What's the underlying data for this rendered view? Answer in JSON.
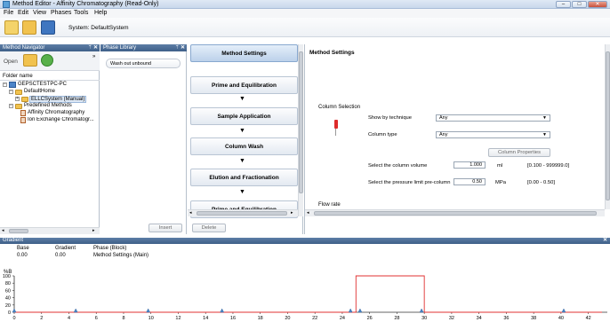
{
  "window": {
    "title": "Method Editor - Affinity Chromatography (Read-Only)",
    "minimize": "–",
    "maximize": "□",
    "close": "✕"
  },
  "menu": [
    "File",
    "Edit",
    "View",
    "Phases",
    "Tools",
    "Help"
  ],
  "toolbar": {
    "system_label": "System: DefaultSystem"
  },
  "navigator": {
    "title": "Method Navigator",
    "pin": "ᛘ",
    "close": "✕",
    "open_label": "Open",
    "chevron": "»",
    "folder_header": "Folder name",
    "tree": {
      "root": "GEPSCTESTPC-PC",
      "default_home": "DefaultHome",
      "ellc": "ELLCSystem (Manual)",
      "predefined": "Predefined Methods",
      "m1": "Affinity Chromatography",
      "m2": "Ion Exchange Chromatogr..."
    }
  },
  "phase_library": {
    "title": "Phase Library",
    "pin": "ᛘ",
    "close": "✕",
    "item": "Wash out unbound",
    "insert": "Insert"
  },
  "phases": {
    "items": [
      "Method Settings",
      "Prime and Equilibration",
      "Sample Application",
      "Column Wash",
      "Elution and Fractionation",
      "Prime and Equilibration"
    ],
    "arrow": "▼",
    "delete": "Delete"
  },
  "editor": {
    "title": "Method Settings",
    "column_selection": "Column Selection",
    "show_by_label": "Show by technique",
    "show_by_value": "Any",
    "column_type_label": "Column type",
    "column_type_value": "Any",
    "column_properties": "Column Properties",
    "volume_label": "Select the column volume",
    "volume_value": "1.000",
    "volume_unit": "ml",
    "volume_range": "[0.100 - 999999.0]",
    "pressure_label": "Select the pressure limit pre-column",
    "pressure_value": "0.50",
    "pressure_unit": "MPa",
    "pressure_range": "[0.00 - 0.50]",
    "flow_rate": "Flow rate"
  },
  "gradient_panel": {
    "title": "Gradient",
    "base_label": "Base",
    "gradient_label": "Gradient",
    "phase_label": "Phase (Block)",
    "base_value": "0.00",
    "gradient_value": "0.00",
    "phase_value": "Method Settings (Main)",
    "close": "✕"
  },
  "chart_data": {
    "type": "line",
    "title": "",
    "xlabel": "",
    "ylabel": "%B",
    "xlim": [
      0,
      43
    ],
    "ylim": [
      0,
      100
    ],
    "x_ticks": [
      0,
      2,
      4,
      6,
      8,
      10,
      12,
      14,
      16,
      18,
      20,
      22,
      24,
      26,
      28,
      30,
      32,
      34,
      36,
      38,
      40,
      42
    ],
    "y_ticks": [
      0,
      20,
      40,
      60,
      80,
      100
    ],
    "series": [
      {
        "x": [
          0,
          25,
          25,
          30,
          30,
          43
        ],
        "y": [
          0,
          0,
          100,
          100,
          0,
          0
        ],
        "color": "#e03030"
      }
    ],
    "markers": [
      0,
      4.5,
      9.8,
      15.2,
      24.6,
      25.3,
      29.8,
      40.2
    ],
    "grid": false
  }
}
